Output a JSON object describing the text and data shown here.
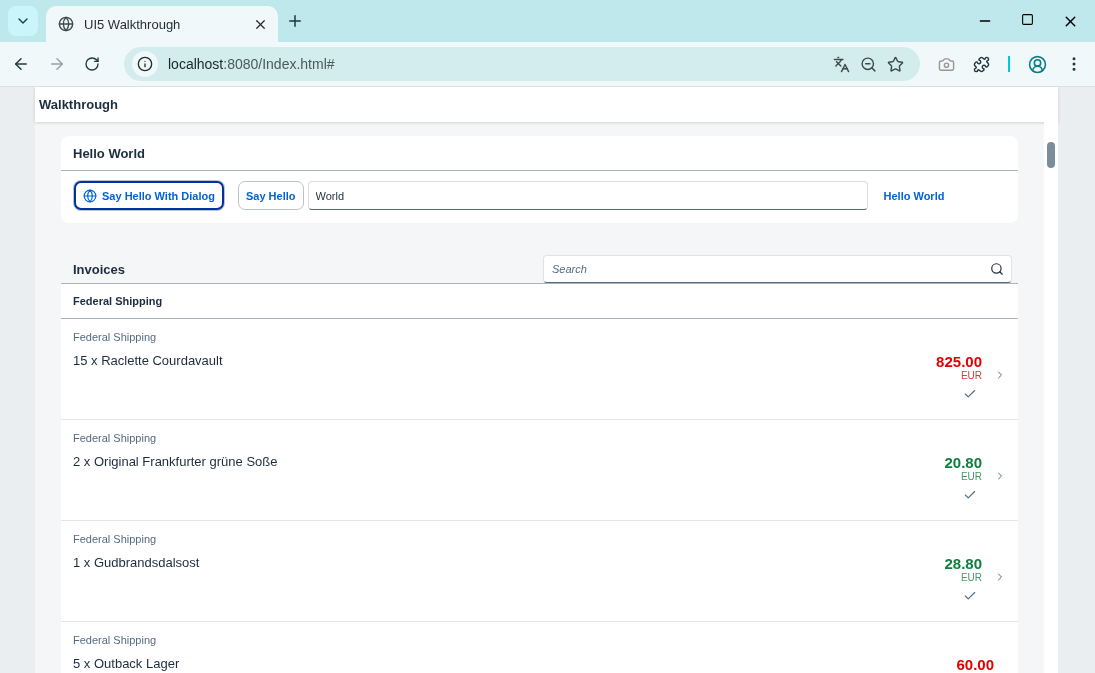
{
  "browser": {
    "tab_title": "UI5 Walkthrough",
    "url_host": "localhost",
    "url_rest": ":8080/Index.html#"
  },
  "shell": {
    "title": "Walkthrough"
  },
  "hello_panel": {
    "title": "Hello World",
    "dialog_button": "Say Hello With Dialog",
    "hello_button": "Say Hello",
    "name_value": "World",
    "greeting": "Hello World"
  },
  "invoices": {
    "title": "Invoices",
    "search": {
      "placeholder": "Search"
    },
    "group": "Federal Shipping",
    "items": [
      {
        "shipper": "Federal Shipping",
        "title": "15 x Raclette Courdavault",
        "amount": "825.00",
        "currency": "EUR",
        "color": "#e00000"
      },
      {
        "shipper": "Federal Shipping",
        "title": "2 x Original Frankfurter grüne Soße",
        "amount": "20.80",
        "currency": "EUR",
        "color": "#107e3e"
      },
      {
        "shipper": "Federal Shipping",
        "title": "1 x Gudbrandsdalsost",
        "amount": "28.80",
        "currency": "EUR",
        "color": "#107e3e"
      },
      {
        "shipper": "Federal Shipping",
        "title": "5 x Outback Lager",
        "amount": "60.00",
        "color": "#e00000"
      }
    ]
  }
}
